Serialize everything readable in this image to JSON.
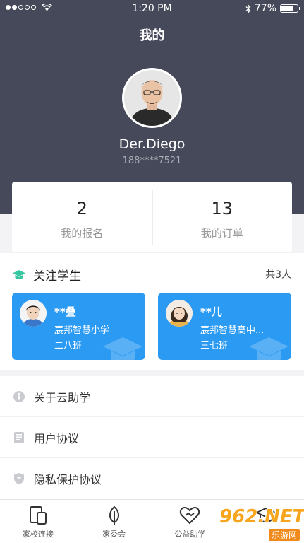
{
  "status_bar": {
    "time": "1:20 PM",
    "battery": "77%",
    "battery_level": 0.77
  },
  "header": {
    "title": "我的",
    "username": "Der.Diego",
    "phone": "188****7521"
  },
  "stats": [
    {
      "value": "2",
      "label": "我的报名"
    },
    {
      "value": "13",
      "label": "我的订单"
    }
  ],
  "follow": {
    "title": "关注学生",
    "count": "共3人",
    "accent": "#2b9af3",
    "students": [
      {
        "name": "**叠",
        "school": "宸邦智慧小学",
        "class": "二八班"
      },
      {
        "name": "**儿",
        "school": "宸邦智慧高中...",
        "class": "三七班"
      }
    ]
  },
  "menu": [
    {
      "label": "关于云助学",
      "icon": "info-icon"
    },
    {
      "label": "用户协议",
      "icon": "document-icon"
    },
    {
      "label": "隐私保护协议",
      "icon": "shield-icon"
    }
  ],
  "tabbar": [
    {
      "label": "家校连接",
      "icon": "devices-icon"
    },
    {
      "label": "家委会",
      "icon": "leaf-icon"
    },
    {
      "label": "公益助学",
      "icon": "heart-icon"
    },
    {
      "label": "",
      "icon": "cap-icon"
    }
  ],
  "watermark": {
    "brand": "962",
    "suffix": ".NET",
    "sub": "乐游网"
  }
}
